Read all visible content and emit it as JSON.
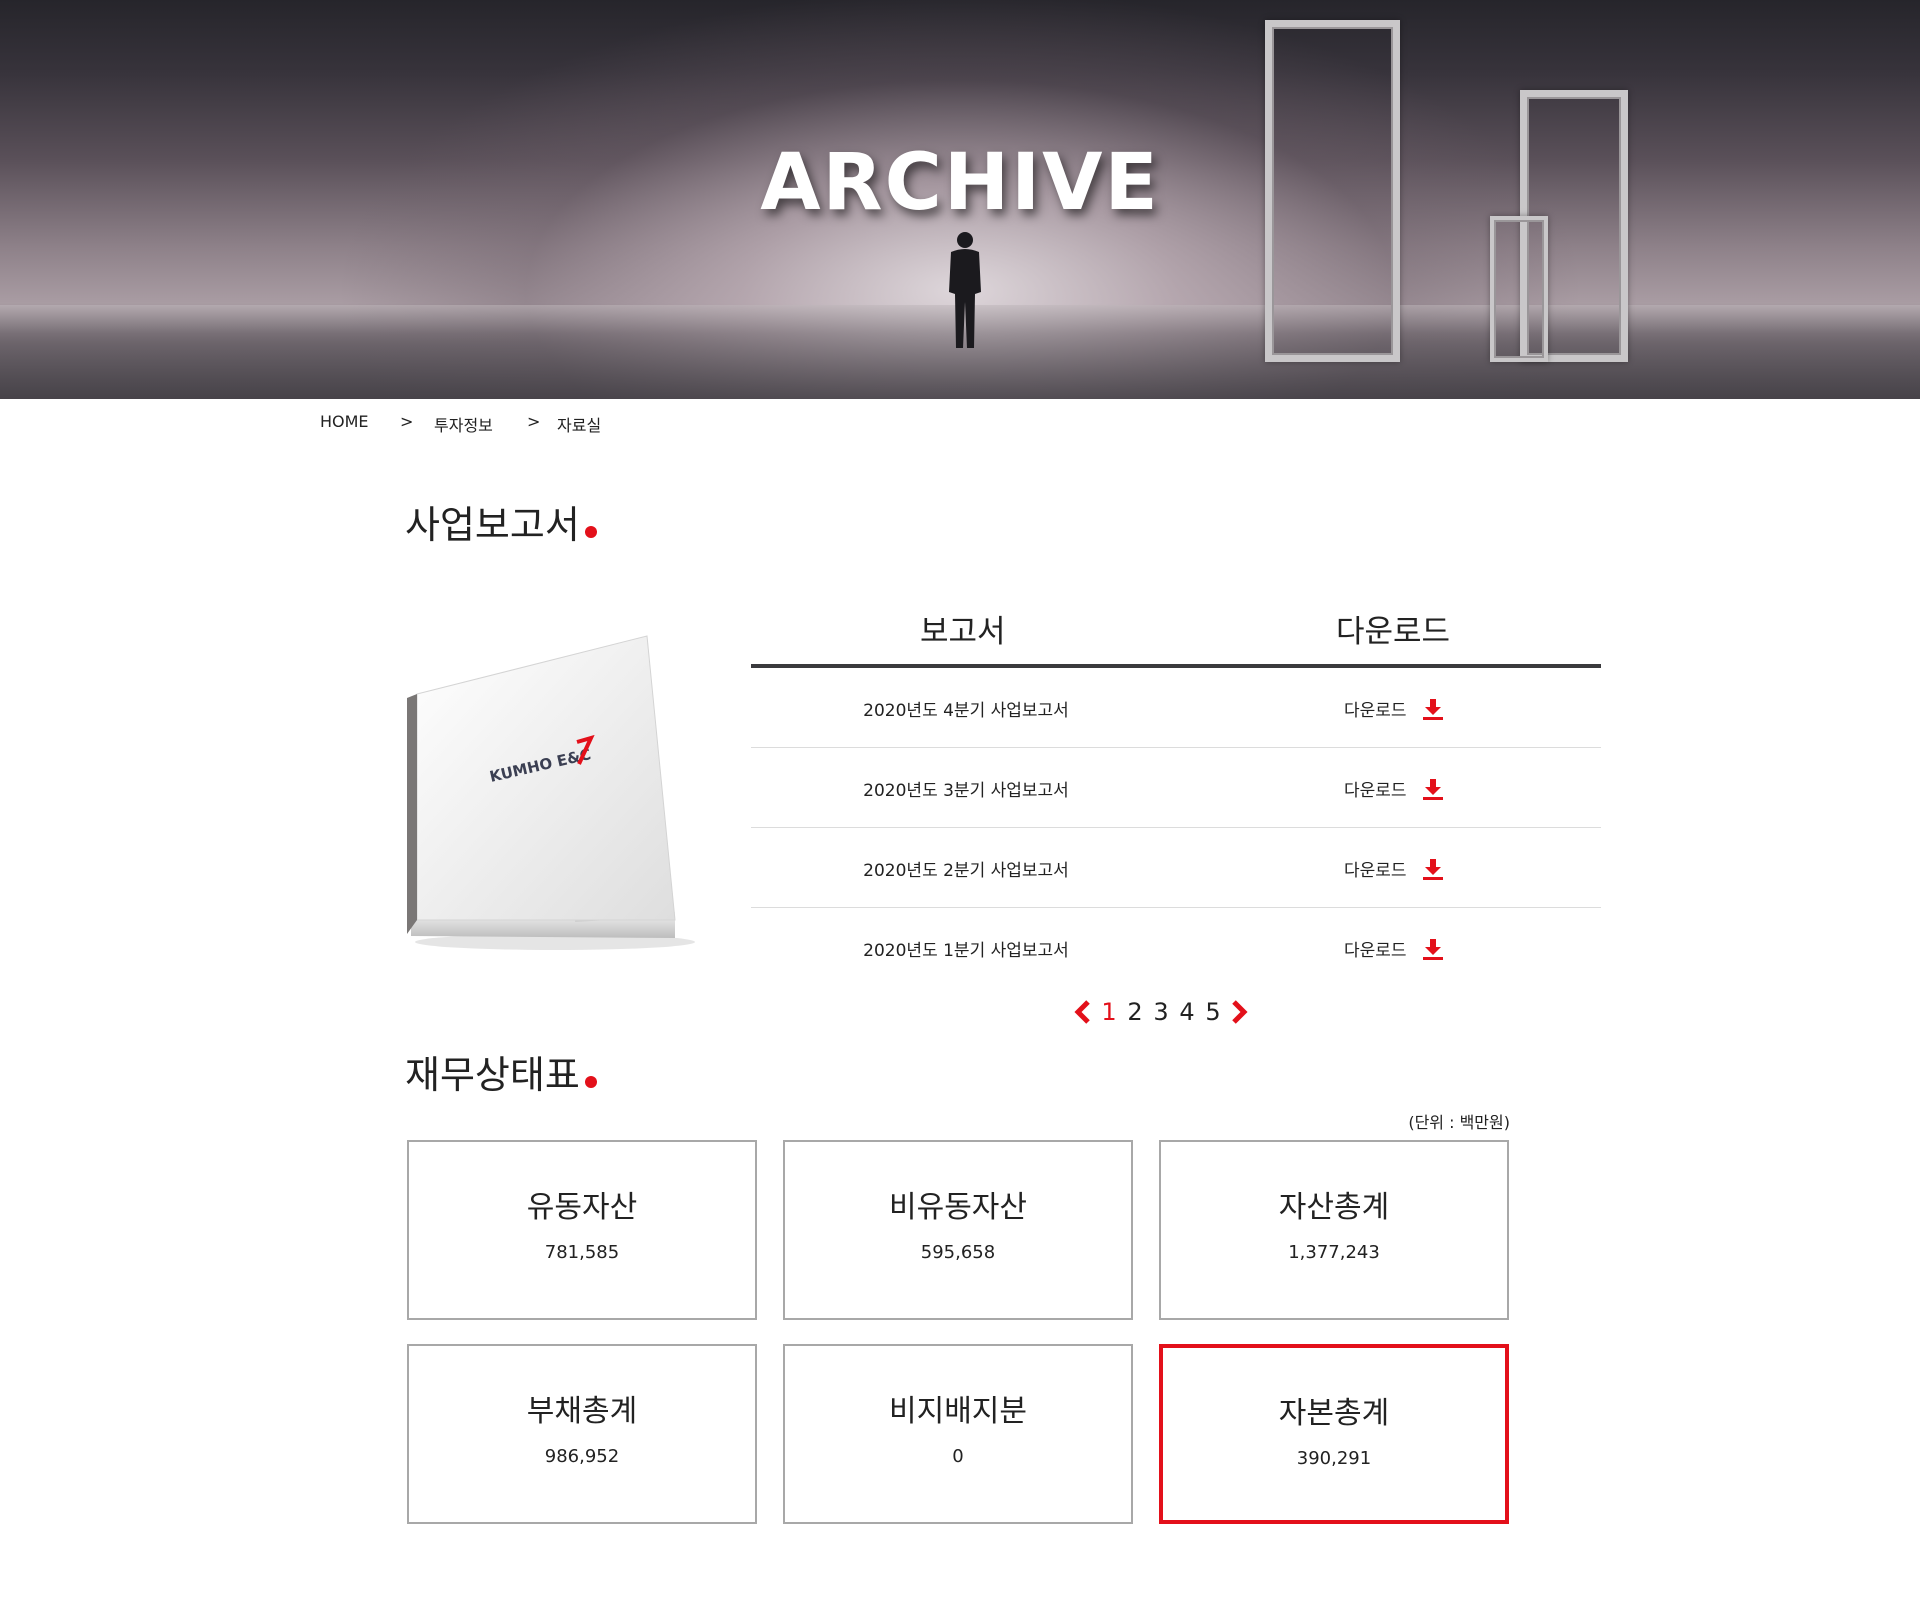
{
  "hero": {
    "title": "ARCHIVE"
  },
  "breadcrumb": {
    "home": "HOME",
    "sep1": ">",
    "level1": "투자정보",
    "sep2": ">",
    "level2": "자료실"
  },
  "business_report": {
    "title": "사업보고서",
    "book_logo": "KUMHO E&C",
    "table": {
      "col_report": "보고서",
      "col_download": "다운로드",
      "rows": [
        {
          "name": "2020년도 4분기 사업보고서",
          "download": "다운로드"
        },
        {
          "name": "2020년도 3분기 사업보고서",
          "download": "다운로드"
        },
        {
          "name": "2020년도 2분기 사업보고서",
          "download": "다운로드"
        },
        {
          "name": "2020년도 1분기 사업보고서",
          "download": "다운로드"
        }
      ]
    },
    "pagination": {
      "pages": [
        "1",
        "2",
        "3",
        "4",
        "5"
      ],
      "current": "1"
    }
  },
  "financial": {
    "title": "재무상태표",
    "unit": "(단위 : 백만원)",
    "cards": [
      {
        "label": "유동자산",
        "value": "781,585"
      },
      {
        "label": "비유동자산",
        "value": "595,658"
      },
      {
        "label": "자산총계",
        "value": "1,377,243"
      },
      {
        "label": "부채총계",
        "value": "986,952"
      },
      {
        "label": "비지배지분",
        "value": "0"
      },
      {
        "label": "자본총계",
        "value": "390,291"
      }
    ]
  },
  "colors": {
    "accent": "#e3101a",
    "divider": "#3a3a3d",
    "card_border": "#a8a8a8"
  }
}
